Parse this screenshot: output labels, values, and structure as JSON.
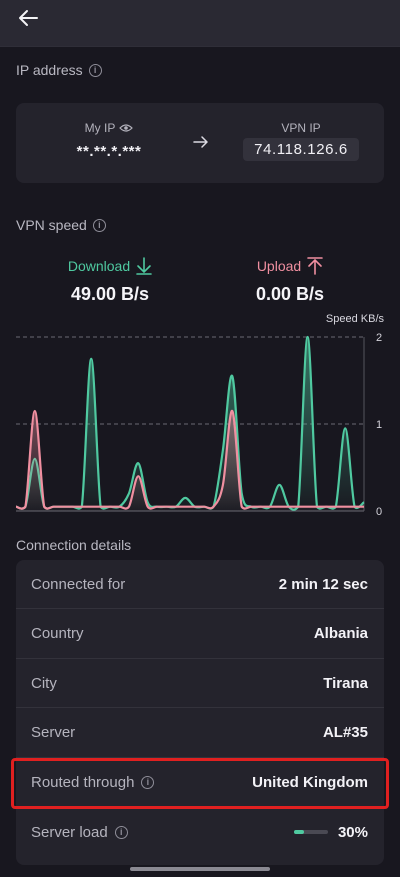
{
  "header": {
    "back_icon": "arrow-left-icon"
  },
  "ip_section": {
    "title": "IP address",
    "my_ip_label": "My IP",
    "my_ip_value": "**.**.*.***",
    "vpn_ip_label": "VPN IP",
    "vpn_ip_value": "74.118.126.6"
  },
  "speed_section": {
    "title": "VPN speed",
    "download_label": "Download",
    "download_value": "49.00 B/s",
    "upload_label": "Upload",
    "upload_value": "0.00 B/s"
  },
  "chart_data": {
    "type": "area",
    "ylabel": "Speed KB/s",
    "ylim": [
      0,
      2
    ],
    "yticks": [
      "2",
      "1",
      "0"
    ],
    "grid": true,
    "series": [
      {
        "name": "Download",
        "color": "#4fc9a0",
        "values": [
          0.05,
          0.05,
          0.6,
          0.05,
          0.05,
          0.05,
          0.05,
          0.05,
          1.75,
          0.05,
          0.05,
          0.05,
          0.2,
          0.55,
          0.1,
          0.05,
          0.05,
          0.05,
          0.15,
          0.05,
          0.05,
          0.05,
          0.7,
          1.55,
          0.2,
          0.05,
          0.05,
          0.05,
          0.3,
          0.05,
          0.05,
          2.0,
          0.05,
          0.05,
          0.05,
          0.95,
          0.05,
          0.1
        ]
      },
      {
        "name": "Upload",
        "color": "#f08fa0",
        "values": [
          0.05,
          0.05,
          1.15,
          0.05,
          0.05,
          0.05,
          0.05,
          0.05,
          0.05,
          0.05,
          0.05,
          0.05,
          0.05,
          0.4,
          0.05,
          0.05,
          0.05,
          0.05,
          0.05,
          0.05,
          0.05,
          0.05,
          0.3,
          1.15,
          0.05,
          0.05,
          0.05,
          0.05,
          0.05,
          0.05,
          0.05,
          0.05,
          0.05,
          0.05,
          0.05,
          0.05,
          0.05,
          0.05
        ]
      }
    ]
  },
  "details_section": {
    "title": "Connection details",
    "rows": [
      {
        "key": "Connected for",
        "value": "2 min 12 sec"
      },
      {
        "key": "Country",
        "value": "Albania"
      },
      {
        "key": "City",
        "value": "Tirana"
      },
      {
        "key": "Server",
        "value": "AL#35"
      },
      {
        "key": "Routed through",
        "value": "United Kingdom"
      },
      {
        "key": "Server load",
        "value": "30%",
        "load_fraction": 0.3
      }
    ]
  },
  "colors": {
    "accent_green": "#4fc9a0",
    "accent_pink": "#f08fa0",
    "highlight": "#e02020"
  }
}
